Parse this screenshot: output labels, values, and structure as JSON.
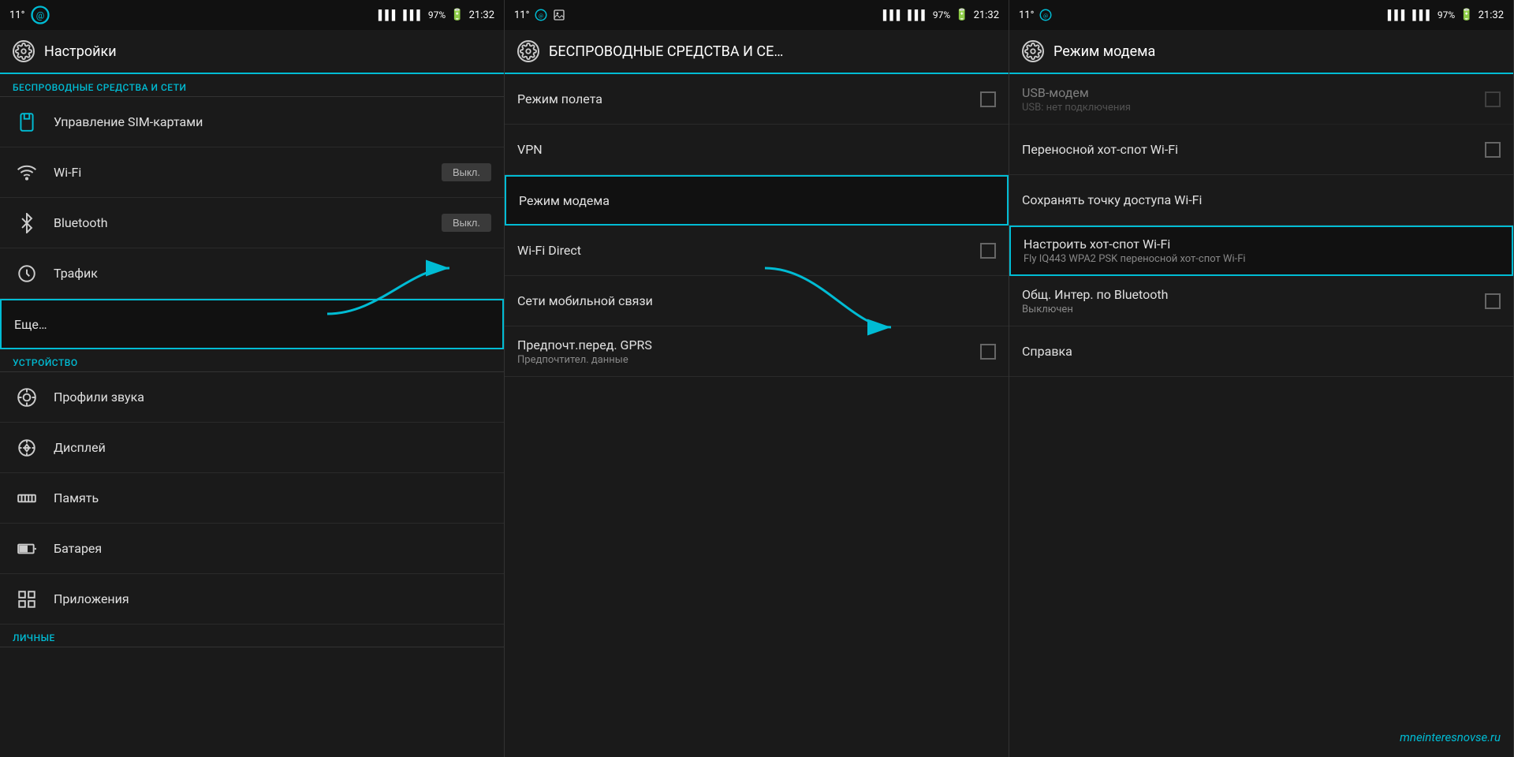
{
  "colors": {
    "accent": "#00bcd4",
    "bg": "#1a1a1a",
    "text_primary": "#e0e0e0",
    "text_secondary": "#888888",
    "status_bg": "#111111"
  },
  "panel1": {
    "status": {
      "left": "11°",
      "signal1": "▌▌▌",
      "signal2": "▌▌▌",
      "battery": "97%",
      "time": "21:32"
    },
    "title": "Настройки",
    "section1": "БЕСПРОВОДНЫЕ СРЕДСТВА И СЕТИ",
    "items": [
      {
        "label": "Управление SIM-картами",
        "icon": "sim",
        "toggle": null
      },
      {
        "label": "Wi-Fi",
        "icon": "wifi",
        "toggle": "Выкл."
      },
      {
        "label": "Bluetooth",
        "icon": "bluetooth",
        "toggle": "Выкл."
      },
      {
        "label": "Трафик",
        "icon": "traffic",
        "toggle": null
      },
      {
        "label": "Еще…",
        "icon": null,
        "toggle": null,
        "highlighted": true
      }
    ],
    "section2": "УСТРОЙСТВО",
    "items2": [
      {
        "label": "Профили звука",
        "icon": "profile"
      },
      {
        "label": "Дисплей",
        "icon": "display"
      },
      {
        "label": "Память",
        "icon": "memory"
      },
      {
        "label": "Батарея",
        "icon": "battery"
      },
      {
        "label": "Приложения",
        "icon": "apps"
      }
    ],
    "section3": "ЛИЧНЫЕ"
  },
  "panel2": {
    "status": {
      "left": "11°",
      "time": "21:32"
    },
    "title": "БЕСПРОВОДНЫЕ СРЕДСТВА И СЕ…",
    "items": [
      {
        "label": "Режим полета",
        "subtitle": null,
        "checkbox": true,
        "checked": false,
        "highlighted": false
      },
      {
        "label": "VPN",
        "subtitle": null,
        "checkbox": false,
        "highlighted": false
      },
      {
        "label": "Режим модема",
        "subtitle": null,
        "checkbox": false,
        "highlighted": true
      },
      {
        "label": "Wi-Fi Direct",
        "subtitle": null,
        "checkbox": true,
        "checked": false,
        "highlighted": false
      },
      {
        "label": "Сети мобильной связи",
        "subtitle": null,
        "checkbox": false,
        "highlighted": false
      },
      {
        "label": "Предпочт.перед. GPRS",
        "subtitle": "Предпочтител. данные",
        "checkbox": true,
        "checked": false,
        "highlighted": false
      }
    ]
  },
  "panel3": {
    "status": {
      "left": "11°",
      "time": "21:32"
    },
    "title": "Режим модема",
    "items": [
      {
        "label": "USB-модем",
        "subtitle": "USB: нет подключения",
        "checkbox": true,
        "checked": false,
        "highlighted": false,
        "disabled": true
      },
      {
        "label": "Переносной хот-спот Wi-Fi",
        "subtitle": null,
        "checkbox": true,
        "checked": false,
        "highlighted": false
      },
      {
        "label": "Сохранять точку доступа Wi-Fi",
        "subtitle": null,
        "checkbox": false,
        "highlighted": false
      },
      {
        "label": "Настроить хот-спот Wi-Fi",
        "subtitle": "Fly IQ443 WPA2 PSK переносной хот-спот Wi-Fi",
        "checkbox": false,
        "highlighted": true
      },
      {
        "label": "Общ. Интер. по Bluetooth",
        "subtitle": "Выключен",
        "checkbox": true,
        "checked": false,
        "highlighted": false
      },
      {
        "label": "Справка",
        "subtitle": null,
        "checkbox": false,
        "highlighted": false
      }
    ],
    "watermark": "mneinteresnovse.ru"
  }
}
